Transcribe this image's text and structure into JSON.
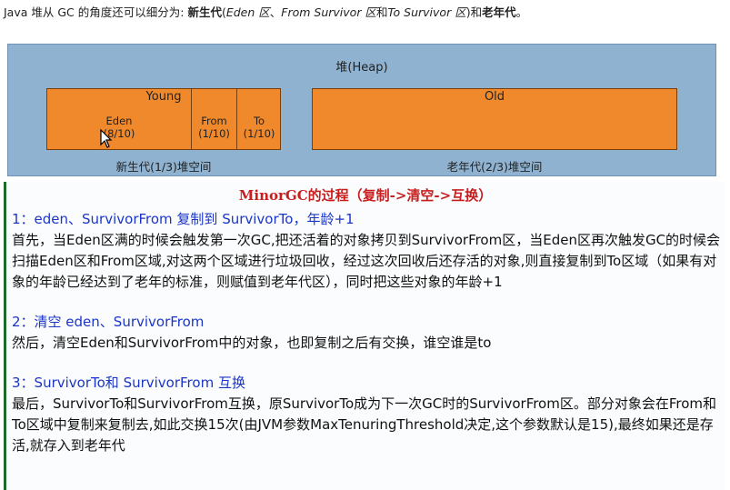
{
  "intro": {
    "prefix": "Java 堆从 GC 的角度还可以细分为: ",
    "young_gen": "新生代",
    "open": "(",
    "eden_area": "Eden 区",
    "sep": "、",
    "from_area": "From Survivor 区",
    "and": "和",
    "to_area": "To Survivor 区",
    "close_and": ")和",
    "old_gen": "老年代",
    "end": "。"
  },
  "heap": {
    "title": "堆(Heap)",
    "young": {
      "title": "Young",
      "eden_label": "Eden",
      "eden_ratio": "(8/10)",
      "from_label": "From",
      "from_ratio": "(1/10)",
      "to_label": "To",
      "to_ratio": "(1/10)",
      "caption": "新生代(1/3)堆空间"
    },
    "old": {
      "title": "Old",
      "caption": "老年代(2/3)堆空间"
    }
  },
  "article": {
    "heading": "MinorGC的过程（复制->清空->互换）",
    "steps": [
      {
        "title": "1：eden、SurvivorFrom 复制到 SurvivorTo，年龄+1",
        "body": "首先，当Eden区满的时候会触发第一次GC,把还活着的对象拷贝到SurvivorFrom区，当Eden区再次触发GC的时候会扫描Eden区和From区域,对这两个区域进行垃圾回收，经过这次回收后还存活的对象,则直接复制到To区域（如果有对象的年龄已经达到了老年的标准，则赋值到老年代区），同时把这些对象的年龄+1"
      },
      {
        "title": "2：清空 eden、SurvivorFrom",
        "body": "然后，清空Eden和SurvivorFrom中的对象，也即复制之后有交换，谁空谁是to"
      },
      {
        "title": "3：SurvivorTo和 SurvivorFrom 互换",
        "body": "最后，SurvivorTo和SurvivorFrom互换，原SurvivorTo成为下一次GC时的SurvivorFrom区。部分对象会在From和To区域中复制来复制去,如此交换15次(由JVM参数MaxTenuringThreshold决定,这个参数默认是15),最终如果还是存活,就存入到老年代"
      }
    ]
  },
  "colors": {
    "heap_bg": "#8fb2d1",
    "region_fill": "#f0892c",
    "heading_red": "#c81e1e",
    "step_blue": "#1b35c8",
    "left_rule_green": "#1e6b2e"
  },
  "icons": [
    "mouse-pointer-icon"
  ]
}
